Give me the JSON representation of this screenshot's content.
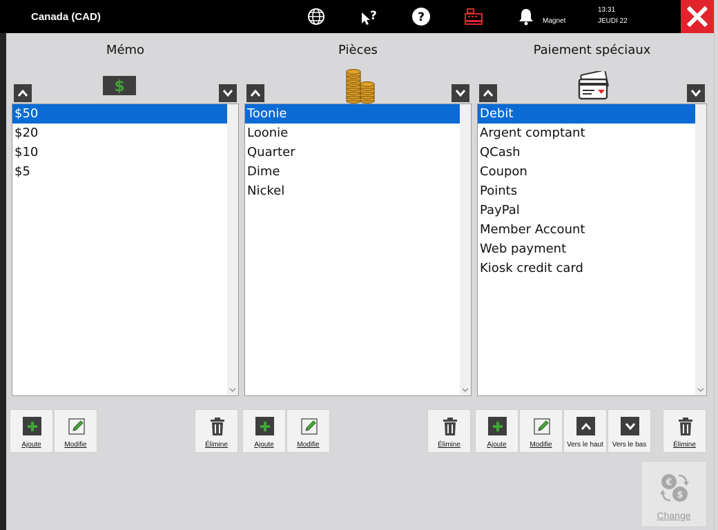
{
  "header": {
    "region": "Canada (CAD)",
    "magnet_label": "Magnet",
    "time": "13:31",
    "day": "JEUDI 22"
  },
  "panels": {
    "memo": {
      "title": "Mémo",
      "items": [
        "$50",
        "$20",
        "$10",
        "$5"
      ],
      "selected_index": 0
    },
    "pieces": {
      "title": "Pièces",
      "items": [
        "Toonie",
        "Loonie",
        "Quarter",
        "Dime",
        "Nickel"
      ],
      "selected_index": 0
    },
    "special": {
      "title": "Paiement spéciaux",
      "items": [
        "Debit",
        "Argent comptant",
        "QCash",
        "Coupon",
        "Points",
        "PayPal",
        "Member Account",
        "Web payment",
        "Kiosk credit card"
      ],
      "selected_index": 0
    }
  },
  "toolbar": {
    "add": "Ajoute",
    "edit": "Modifie",
    "delete": "Élimine",
    "move_up": "Vers le haut",
    "move_down": "Vers le bas",
    "change": "Change"
  },
  "colors": {
    "accent_selection": "#0a6bd4",
    "close_red": "#e1242c",
    "add_green": "#3fa535"
  }
}
